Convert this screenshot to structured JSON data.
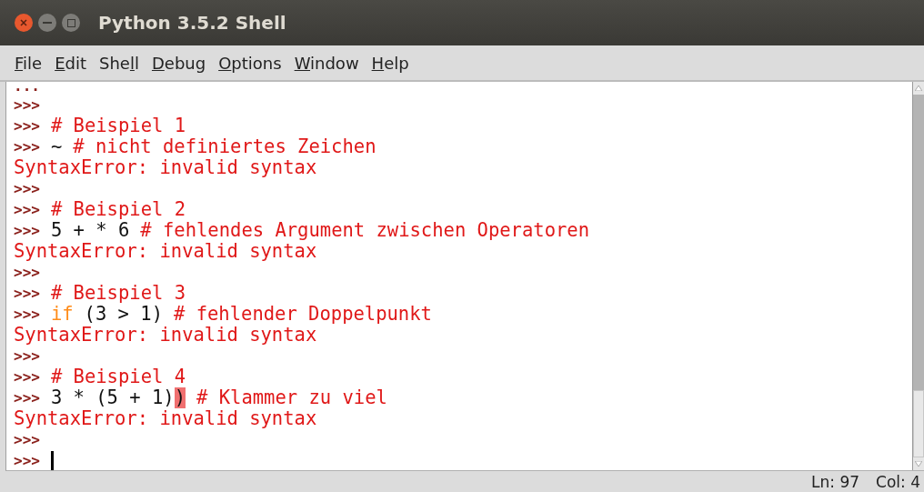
{
  "window": {
    "title": "Python 3.5.2 Shell"
  },
  "menu": [
    {
      "parts": [
        {
          "text": "F",
          "underline": true
        },
        {
          "text": "ile",
          "underline": false
        }
      ]
    },
    {
      "parts": [
        {
          "text": "E",
          "underline": true
        },
        {
          "text": "dit",
          "underline": false
        }
      ]
    },
    {
      "parts": [
        {
          "text": "She",
          "underline": false
        },
        {
          "text": "l",
          "underline": true
        },
        {
          "text": "l",
          "underline": false
        }
      ]
    },
    {
      "parts": [
        {
          "text": "D",
          "underline": true
        },
        {
          "text": "ebug",
          "underline": false
        }
      ]
    },
    {
      "parts": [
        {
          "text": "O",
          "underline": true
        },
        {
          "text": "ptions",
          "underline": false
        }
      ]
    },
    {
      "parts": [
        {
          "text": "W",
          "underline": true
        },
        {
          "text": "indow",
          "underline": false
        }
      ]
    },
    {
      "parts": [
        {
          "text": "H",
          "underline": true
        },
        {
          "text": "elp",
          "underline": false
        }
      ]
    }
  ],
  "shell": {
    "lines": [
      [
        {
          "kind": "prompt",
          "text": "..."
        }
      ],
      [
        {
          "kind": "prompt",
          "text": ">>>"
        }
      ],
      [
        {
          "kind": "prompt",
          "text": ">>>"
        },
        {
          "kind": "comment",
          "text": "# Beispiel 1"
        }
      ],
      [
        {
          "kind": "prompt",
          "text": ">>>"
        },
        {
          "kind": "code",
          "text": "~"
        },
        {
          "kind": "comment",
          "text": "# nicht definiertes Zeichen"
        }
      ],
      [
        {
          "kind": "error",
          "text": "SyntaxError: invalid syntax"
        }
      ],
      [
        {
          "kind": "prompt",
          "text": ">>>"
        }
      ],
      [
        {
          "kind": "prompt",
          "text": ">>>"
        },
        {
          "kind": "comment",
          "text": "# Beispiel 2"
        }
      ],
      [
        {
          "kind": "prompt",
          "text": ">>>"
        },
        {
          "kind": "code",
          "text": "5 + * 6"
        },
        {
          "kind": "comment",
          "text": "# fehlendes Argument zwischen Operatoren"
        }
      ],
      [
        {
          "kind": "error",
          "text": "SyntaxError: invalid syntax"
        }
      ],
      [
        {
          "kind": "prompt",
          "text": ">>>"
        }
      ],
      [
        {
          "kind": "prompt",
          "text": ">>>"
        },
        {
          "kind": "comment",
          "text": "# Beispiel 3"
        }
      ],
      [
        {
          "kind": "prompt",
          "text": ">>>"
        },
        {
          "kind": "keyword",
          "text": "if"
        },
        {
          "kind": "code",
          "text": "(3 > 1)"
        },
        {
          "kind": "comment",
          "text": "# fehlender Doppelpunkt"
        }
      ],
      [
        {
          "kind": "error",
          "text": "SyntaxError: invalid syntax"
        }
      ],
      [
        {
          "kind": "prompt",
          "text": ">>>"
        }
      ],
      [
        {
          "kind": "prompt",
          "text": ">>>"
        },
        {
          "kind": "comment",
          "text": "# Beispiel 4"
        }
      ],
      [
        {
          "kind": "prompt",
          "text": ">>>"
        },
        {
          "kind": "code",
          "text": "3 * (5 + 1)"
        },
        {
          "kind": "highlight",
          "text": ")"
        },
        {
          "kind": "comment",
          "text": "# Klammer zu viel"
        }
      ],
      [
        {
          "kind": "error",
          "text": "SyntaxError: invalid syntax"
        }
      ],
      [
        {
          "kind": "prompt",
          "text": ">>>"
        }
      ],
      [
        {
          "kind": "prompt",
          "text": ">>>"
        },
        {
          "kind": "cursor"
        }
      ]
    ]
  },
  "status_bar": {
    "line": "Ln: 97",
    "column": "Col: 4"
  }
}
